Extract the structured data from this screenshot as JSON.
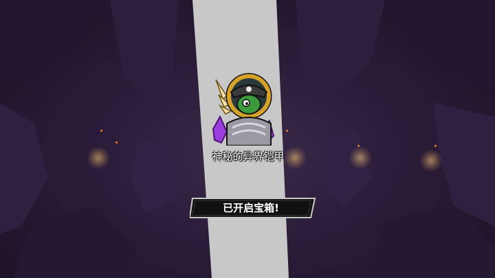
{
  "item": {
    "name": "神秘的异界铠甲",
    "icon": "pirate-goblin-armor-icon"
  },
  "banner": {
    "label": "已开启宝箱!"
  },
  "colors": {
    "background": "#2a1c38",
    "light_beam": "#c8c8c8",
    "icon_ring": "#d7a22a",
    "banner_fill": "#111111",
    "banner_border": "#c9c9c9",
    "ember": "#e07a2a"
  }
}
